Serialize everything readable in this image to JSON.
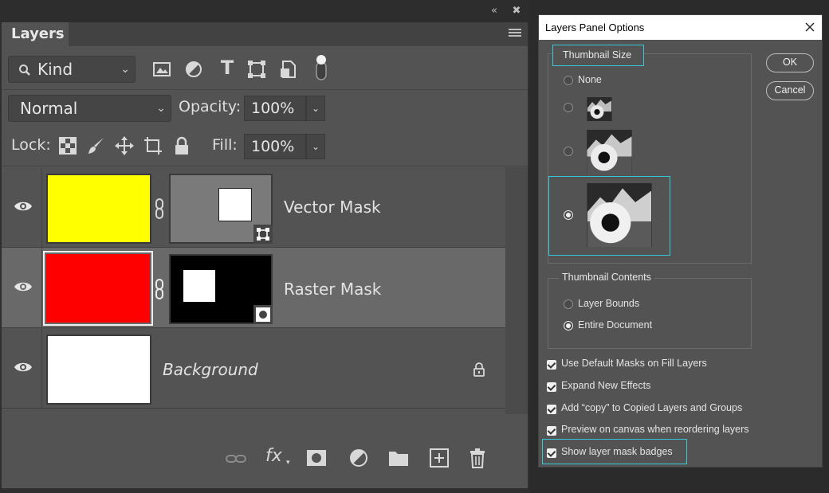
{
  "layers_panel": {
    "tab_title": "Layers",
    "filter": {
      "label": "Kind"
    },
    "blend_mode": {
      "value": "Normal"
    },
    "opacity": {
      "label": "Opacity:",
      "value": "100%"
    },
    "lock_label": "Lock:",
    "fill": {
      "label": "Fill:",
      "value": "100%"
    },
    "layers": [
      {
        "name": "Vector Mask",
        "color": "#ffff00",
        "visible": true,
        "selected": false,
        "mask": "vector"
      },
      {
        "name": "Raster Mask",
        "color": "#ff0000",
        "visible": true,
        "selected": true,
        "mask": "raster"
      },
      {
        "name": "Background",
        "color": "#ffffff",
        "visible": true,
        "selected": false,
        "locked": true
      }
    ],
    "filter_icons": [
      "image-filter-icon",
      "adjustment-filter-icon",
      "type-filter-icon",
      "shape-filter-icon",
      "smart-object-filter-icon",
      "filter-toggle-icon"
    ],
    "lock_icons": [
      "lock-transparent-icon",
      "lock-image-icon",
      "lock-position-icon",
      "lock-artboard-icon",
      "lock-all-icon"
    ],
    "bottom_icons": [
      "link-layers-icon",
      "fx-icon",
      "add-mask-icon",
      "adjustment-layer-icon",
      "new-group-icon",
      "new-layer-icon",
      "delete-layer-icon"
    ],
    "bottom_fx_label": "fx"
  },
  "dialog": {
    "title": "Layers Panel Options",
    "thumbnail_size": {
      "title": "Thumbnail Size",
      "options": [
        {
          "label": "None",
          "checked": false
        },
        {
          "label": "",
          "checked": false
        },
        {
          "label": "",
          "checked": false
        },
        {
          "label": "",
          "checked": true
        }
      ]
    },
    "thumbnail_contents": {
      "title": "Thumbnail Contents",
      "options": [
        {
          "label": "Layer Bounds",
          "checked": false
        },
        {
          "label": "Entire Document",
          "checked": true
        }
      ]
    },
    "checkboxes": [
      {
        "label": "Use Default Masks on Fill Layers",
        "checked": true
      },
      {
        "label": "Expand New Effects",
        "checked": true
      },
      {
        "label": "Add “copy” to Copied Layers and Groups",
        "checked": true
      },
      {
        "label": "Preview on canvas when reordering layers",
        "checked": true
      },
      {
        "label": "Show layer mask badges",
        "checked": true
      }
    ],
    "buttons": {
      "ok": "OK",
      "cancel": "Cancel"
    },
    "highlight_color": "#38c7d6"
  }
}
